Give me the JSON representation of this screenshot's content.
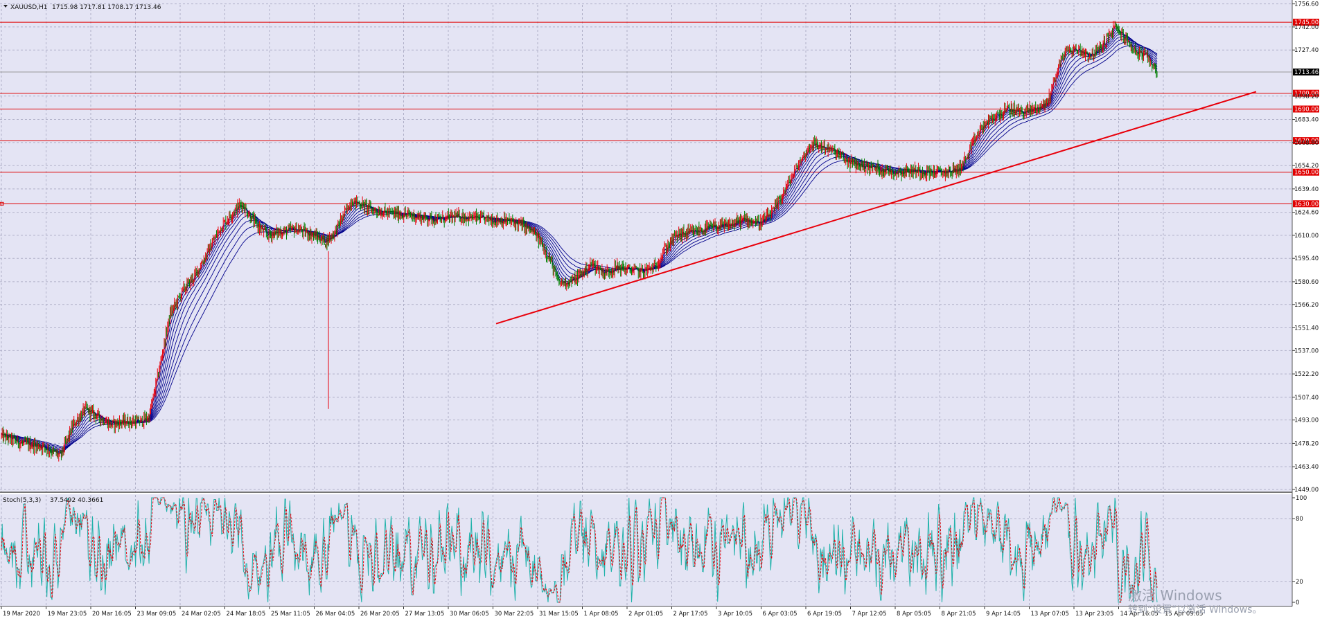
{
  "header": {
    "symbol_label": "XAUUSD,H1",
    "ohlc": "1715.98 1717.81 1708.17 1713.46",
    "stoch_label": "Stoch(5,3,3)",
    "stoch_values": "37.5492 40.3661"
  },
  "watermark": {
    "line1": "激活 Windows",
    "line2": "转到“设置”以激活 Windows。"
  },
  "colors": {
    "background": "#e4e4f4",
    "grid": "#b0b0c8",
    "bull": "#e8000b",
    "bear": "#008000",
    "ma": "#00008b",
    "level_line": "#e00000",
    "trendline": "#e8000b",
    "stoch_main": "#20b2aa",
    "stoch_signal": "#e8000b"
  },
  "chart_data": [
    {
      "type": "candlestick",
      "title": "XAUUSD,H1",
      "ylim": [
        1449.0,
        1756.0
      ],
      "yticks": [
        "1756.60",
        "1742.00",
        "1727.40",
        "1698.20",
        "1683.40",
        "1668.80",
        "1654.20",
        "1639.40",
        "1624.60",
        "1610.00",
        "1595.40",
        "1580.60",
        "1566.20",
        "1551.40",
        "1537.00",
        "1522.20",
        "1507.40",
        "1493.00",
        "1478.20",
        "1463.40",
        "1449.00"
      ],
      "current_price": "1713.46",
      "levels": [
        "1745.00",
        "1700.00",
        "1690.00",
        "1670.00",
        "1650.00",
        "1630.00"
      ],
      "xticks": [
        "19 Mar 2020",
        "19 Mar 23:05",
        "20 Mar 16:05",
        "23 Mar 09:05",
        "24 Mar 02:05",
        "24 Mar 18:05",
        "25 Mar 11:05",
        "26 Mar 04:05",
        "26 Mar 20:05",
        "27 Mar 13:05",
        "30 Mar 06:05",
        "30 Mar 22:05",
        "31 Mar 15:05",
        "1 Apr 08:05",
        "2 Apr 01:05",
        "2 Apr 17:05",
        "3 Apr 10:05",
        "6 Apr 03:05",
        "6 Apr 19:05",
        "7 Apr 12:05",
        "8 Apr 05:05",
        "8 Apr 21:05",
        "9 Apr 14:05",
        "13 Apr 07:05",
        "13 Apr 23:05",
        "14 Apr 16:05",
        "15 Apr 09:05"
      ],
      "price_path": [
        [
          0,
          1483
        ],
        [
          25,
          1478
        ],
        [
          50,
          1476
        ],
        [
          70,
          1470
        ],
        [
          85,
          1490
        ],
        [
          100,
          1500
        ],
        [
          115,
          1495
        ],
        [
          130,
          1490
        ],
        [
          145,
          1492
        ],
        [
          165,
          1492
        ],
        [
          175,
          1495
        ],
        [
          185,
          1520
        ],
        [
          200,
          1560
        ],
        [
          215,
          1575
        ],
        [
          230,
          1585
        ],
        [
          245,
          1600
        ],
        [
          260,
          1615
        ],
        [
          275,
          1625
        ],
        [
          285,
          1630
        ],
        [
          300,
          1618
        ],
        [
          315,
          1610
        ],
        [
          330,
          1612
        ],
        [
          350,
          1614
        ],
        [
          370,
          1610
        ],
        [
          385,
          1606
        ],
        [
          395,
          1612
        ],
        [
          405,
          1622
        ],
        [
          415,
          1632
        ],
        [
          425,
          1630
        ],
        [
          440,
          1626
        ],
        [
          460,
          1624
        ],
        [
          480,
          1623
        ],
        [
          500,
          1621
        ],
        [
          520,
          1620
        ],
        [
          540,
          1622
        ],
        [
          560,
          1621
        ],
        [
          580,
          1620
        ],
        [
          600,
          1619
        ],
        [
          615,
          1617
        ],
        [
          630,
          1612
        ],
        [
          640,
          1605
        ],
        [
          650,
          1595
        ],
        [
          660,
          1580
        ],
        [
          668,
          1580
        ],
        [
          680,
          1582
        ],
        [
          700,
          1592
        ],
        [
          715,
          1586
        ],
        [
          730,
          1590
        ],
        [
          745,
          1588
        ],
        [
          760,
          1587
        ],
        [
          775,
          1590
        ],
        [
          785,
          1600
        ],
        [
          800,
          1610
        ],
        [
          820,
          1612
        ],
        [
          840,
          1615
        ],
        [
          860,
          1616
        ],
        [
          880,
          1620
        ],
        [
          900,
          1618
        ],
        [
          915,
          1625
        ],
        [
          930,
          1640
        ],
        [
          945,
          1655
        ],
        [
          960,
          1668
        ],
        [
          975,
          1666
        ],
        [
          990,
          1662
        ],
        [
          1005,
          1656
        ],
        [
          1020,
          1654
        ],
        [
          1040,
          1652
        ],
        [
          1060,
          1650
        ],
        [
          1080,
          1651
        ],
        [
          1100,
          1650
        ],
        [
          1120,
          1650
        ],
        [
          1135,
          1652
        ],
        [
          1145,
          1660
        ],
        [
          1155,
          1672
        ],
        [
          1165,
          1680
        ],
        [
          1180,
          1686
        ],
        [
          1195,
          1690
        ],
        [
          1210,
          1688
        ],
        [
          1225,
          1690
        ],
        [
          1240,
          1694
        ],
        [
          1250,
          1712
        ],
        [
          1260,
          1726
        ],
        [
          1275,
          1728
        ],
        [
          1290,
          1724
        ],
        [
          1300,
          1727
        ],
        [
          1310,
          1734
        ],
        [
          1320,
          1742
        ],
        [
          1330,
          1736
        ],
        [
          1345,
          1726
        ],
        [
          1360,
          1722
        ],
        [
          1370,
          1713
        ]
      ],
      "series": [
        {
          "name": "",
          "kind": "moving-average",
          "period": 4
        },
        {
          "name": "",
          "kind": "moving-average",
          "period": 7
        },
        {
          "name": "",
          "kind": "moving-average",
          "period": 11
        },
        {
          "name": "",
          "kind": "moving-average",
          "period": 16
        },
        {
          "name": "",
          "kind": "moving-average",
          "period": 22
        },
        {
          "name": "",
          "kind": "moving-average",
          "period": 30
        },
        {
          "name": "",
          "kind": "moving-average",
          "period": 40
        },
        {
          "name": "",
          "kind": "moving-average",
          "period": 52
        },
        {
          "name": "",
          "kind": "moving-average",
          "period": 66
        }
      ],
      "trendline": [
        [
          1597,
          1554
        ],
        [
          1843,
          1701
        ]
      ],
      "spike": [
        [
          474,
          1600
        ],
        [
          474,
          1500
        ]
      ],
      "grid": true
    },
    {
      "type": "line",
      "title": "Stoch(5,3,3)",
      "ylim": [
        0,
        100
      ],
      "yticks": [
        "100",
        "80",
        "20",
        "0"
      ],
      "series": [
        {
          "name": "",
          "kind": "stochastic-main"
        },
        {
          "name": "",
          "kind": "stochastic-signal"
        }
      ],
      "grid": true
    }
  ]
}
